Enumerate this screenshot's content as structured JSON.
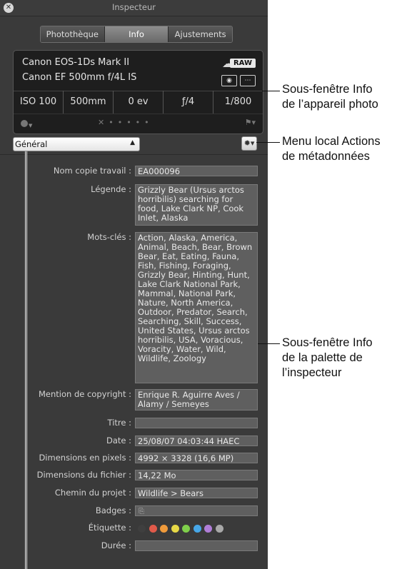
{
  "window": {
    "title": "Inspecteur"
  },
  "tabs": [
    {
      "label": "Photothèque"
    },
    {
      "label": "Info"
    },
    {
      "label": "Ajustements"
    }
  ],
  "camera": {
    "model": "Canon EOS-1Ds Mark II",
    "lens": "Canon EF 500mm f/4L IS",
    "raw_badge": "RAW",
    "iso": "ISO 100",
    "focal": "500mm",
    "ev": "0 ev",
    "aperture": "ƒ/4",
    "shutter": "1/800"
  },
  "preset_select": {
    "value": "Général"
  },
  "metadata": {
    "work_name_label": "Nom copie travail :",
    "work_name": "EA000096",
    "caption_label": "Légende :",
    "caption": "Grizzly Bear (Ursus arctos horribilis) searching for food, Lake Clark NP, Cook Inlet, Alaska",
    "keywords_label": "Mots-clés :",
    "keywords": "Action, Alaska, America, Animal, Beach, Bear, Brown Bear, Eat, Eating, Fauna, Fish, Fishing, Foraging, Grizzly Bear, Hinting, Hunt, Lake Clark National Park, Mammal, National Park, Nature, North America, Outdoor, Predator, Search, Searching, Skill, Success, United States, Ursus arctos horribilis, USA, Voracious, Voracity, Water, Wild, Wildlife, Zoology",
    "copyright_label": "Mention de copyright :",
    "copyright": "Enrique R. Aguirre Aves / Alamy / Semeyes",
    "title_label": "Titre :",
    "title": "",
    "date_label": "Date :",
    "date": "25/08/07 04:03:44 HAEC",
    "pixel_dims_label": "Dimensions en pixels :",
    "pixel_dims": "4992 × 3328 (16,6 MP)",
    "file_size_label": "Dimensions du fichier :",
    "file_size": "14,22 Mo",
    "project_path_label": "Chemin du projet :",
    "project_path": "Wildlife > Bears",
    "badges_label": "Badges :",
    "label_label": "Étiquette :",
    "duration_label": "Durée :",
    "duration": ""
  },
  "label_colors": [
    "#3f3f3f",
    "#e05a4a",
    "#ef9a3b",
    "#e6d846",
    "#7fcf4b",
    "#47a7e8",
    "#b07ed8",
    "#a8a8a8"
  ],
  "callouts": {
    "camera_pane": "Sous-fenêtre Info\nde l’appareil photo",
    "actions_menu": "Menu local Actions\nde métadonnées",
    "palette_pane": "Sous-fenêtre Info\nde la palette de\nl’inspecteur"
  }
}
